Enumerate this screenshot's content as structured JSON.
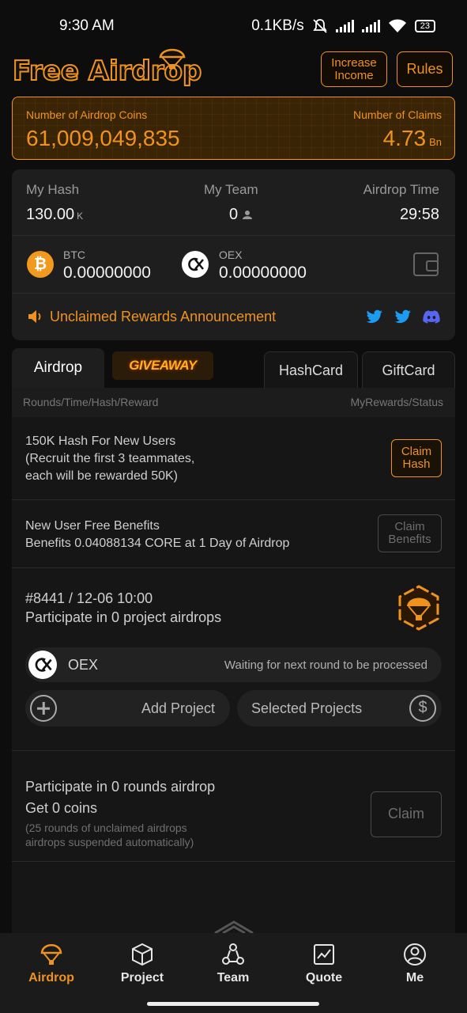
{
  "status_bar": {
    "time": "9:30 AM",
    "net_speed": "0.1KB/s",
    "battery": "23"
  },
  "header": {
    "logo_text": "Free Airdrop",
    "increase_income_label": "Increase Income",
    "rules_label": "Rules"
  },
  "banner": {
    "coins_label": "Number of Airdrop Coins",
    "coins_value": "61,009,049,835",
    "claims_label": "Number of Claims",
    "claims_value": "4.73",
    "claims_unit": "Bn"
  },
  "stats": {
    "hash_label": "My Hash",
    "hash_value": "130.00",
    "hash_unit": "K",
    "team_label": "My Team",
    "team_value": "0",
    "time_label": "Airdrop Time",
    "time_value": "29:58",
    "btc_name": "BTC",
    "btc_value": "0.00000000",
    "oex_name": "OEX",
    "oex_value": "0.00000000",
    "announcement": "Unclaimed Rewards Announcement"
  },
  "tabs": {
    "airdrop": "Airdrop",
    "giveaway": "GIVEAWAY",
    "hashcard": "HashCard",
    "giftcard": "GiftCard"
  },
  "list_header": {
    "left": "Rounds/Time/Hash/Reward",
    "right": "MyRewards/Status"
  },
  "rows": {
    "new_users": {
      "line1": "150K Hash For New Users",
      "line2": "(Recruit the first 3 teammates,",
      "line3": "each will be rewarded 50K)",
      "button": "Claim Hash"
    },
    "benefits": {
      "line1": "New User Free Benefits",
      "line2": "Benefits 0.04088134 CORE at 1 Day of Airdrop",
      "button": "Claim Benefits"
    },
    "round": {
      "title": "#8441 / 12-06 10:00",
      "subtitle": "Participate in 0 project airdrops",
      "project_name": "OEX",
      "project_status": "Waiting for next round to be processed",
      "add_project": "Add Project",
      "selected_projects": "Selected Projects"
    },
    "claim": {
      "line1": "Participate in 0 rounds airdrop",
      "line2": "Get 0 coins",
      "note1": "(25 rounds of unclaimed airdrops",
      "note2": "airdrops suspended automatically)",
      "button": "Claim"
    }
  },
  "nav": {
    "airdrop": "Airdrop",
    "project": "Project",
    "team": "Team",
    "quote": "Quote",
    "me": "Me"
  },
  "colors": {
    "accent": "#f0931e",
    "background": "#0d0d0d",
    "card": "#1e1e1e"
  }
}
